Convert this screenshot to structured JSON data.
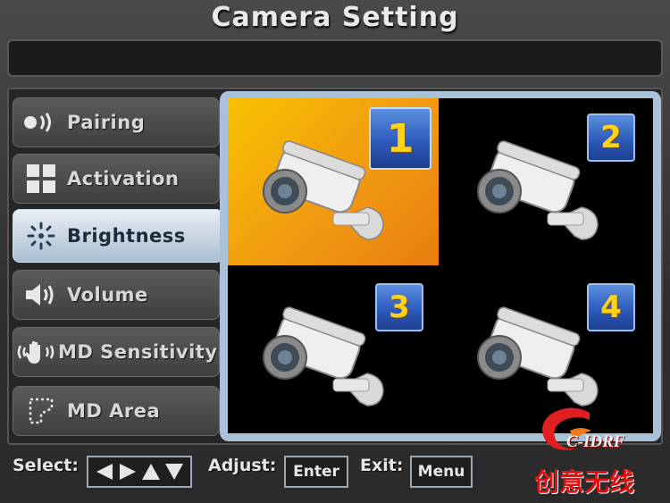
{
  "title": "Camera Setting",
  "menu": {
    "items": [
      {
        "label": "Pairing",
        "icon": "pairing-icon"
      },
      {
        "label": "Activation",
        "icon": "activation-icon"
      },
      {
        "label": "Brightness",
        "icon": "brightness-icon",
        "active": true
      },
      {
        "label": "Volume",
        "icon": "speaker-icon"
      },
      {
        "label": "MD Sensitivity",
        "icon": "hand-icon"
      },
      {
        "label": "MD Area",
        "icon": "area-icon"
      }
    ]
  },
  "cameras": [
    {
      "number": "1",
      "selected": true
    },
    {
      "number": "2",
      "selected": false
    },
    {
      "number": "3",
      "selected": false
    },
    {
      "number": "4",
      "selected": false
    }
  ],
  "footer": {
    "select_label": "Select:",
    "adjust_label": "Adjust:",
    "adjust_key": "Enter",
    "exit_label": "Exit:",
    "exit_key": "Menu"
  },
  "watermark": {
    "latin": "C-IDRF",
    "chinese": "创意无线"
  },
  "colors": {
    "selected_cell": "#f19a12",
    "active_menu": "#c7d6e6",
    "badge": "#2a57b8",
    "badge_digit": "#ffd21a"
  }
}
